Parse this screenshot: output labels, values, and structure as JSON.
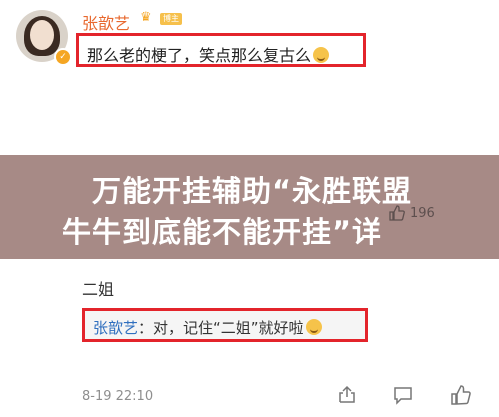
{
  "comment": {
    "username": "张歆艺",
    "member_badge": "博主",
    "text": "那么老的梗了，笑点那么复古么",
    "emoji": "laugh-emoji"
  },
  "overlay": {
    "line1": "万能开挂辅助“永胜联盟",
    "line2": "牛牛到底能不能开挂”详"
  },
  "stats": {
    "likes": "196"
  },
  "reply": {
    "name": "二姐",
    "author": "张歆艺",
    "text": "：对，记住“二姐”就好啦",
    "emoji": "laugh-emoji"
  },
  "footer": {
    "time": "8-19 22:10"
  },
  "colors": {
    "accent": "#e8692f",
    "highlight_border": "#e3242b",
    "overlay": "#a78a86",
    "link_blue": "#2f6fbf"
  }
}
